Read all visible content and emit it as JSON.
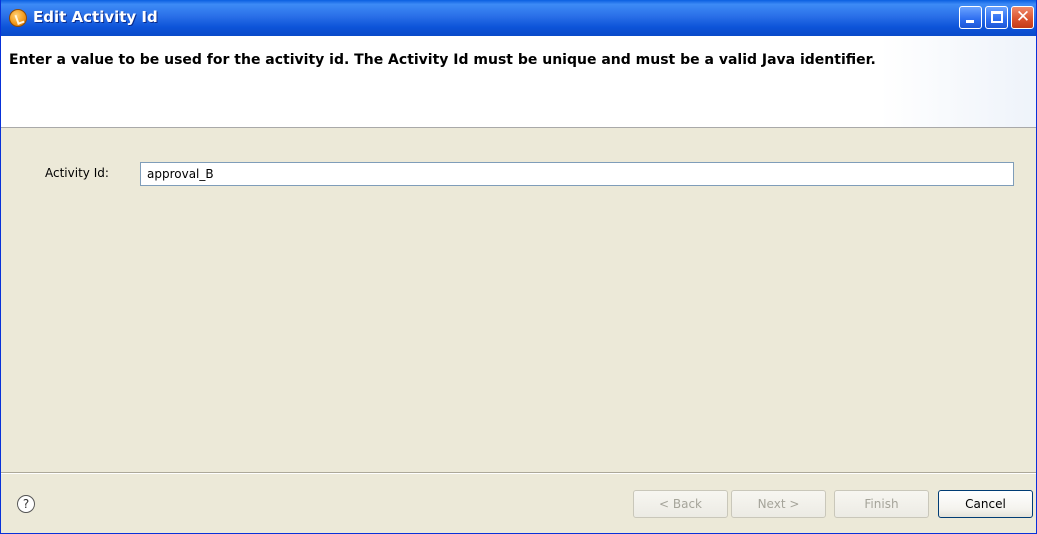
{
  "window": {
    "title": "Edit Activity Id",
    "minimize_glyph": "",
    "maximize_glyph": "",
    "close_glyph": "✕"
  },
  "banner": {
    "message": "Enter a value to be used for the activity id.  The Activity Id must be unique and must be a valid Java identifier."
  },
  "form": {
    "activity_id_label": "Activity Id:",
    "activity_id_value": "approval_B"
  },
  "footer": {
    "help_glyph": "?",
    "back_label": "< Back",
    "next_label": "Next >",
    "finish_label": "Finish",
    "cancel_label": "Cancel"
  },
  "icons": {
    "app": "activity-app-icon",
    "help": "help-icon"
  },
  "colors": {
    "titlebar": "#0a5fe0",
    "dialog_bg": "#ece9d8",
    "close_button": "#d9512c"
  }
}
